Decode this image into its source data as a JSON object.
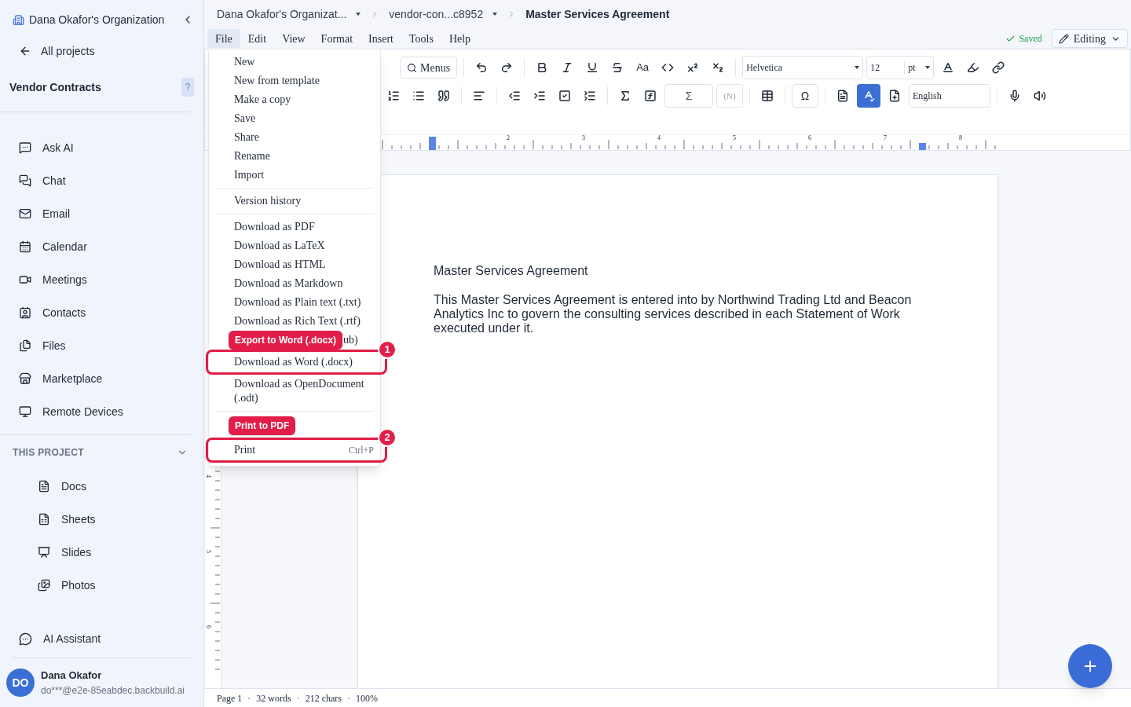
{
  "sidebar": {
    "org": "Dana Okafor's Organization",
    "back": "All projects",
    "project": "Vendor Contracts",
    "help": "?",
    "nav": [
      "Ask AI",
      "Chat",
      "Email",
      "Calendar",
      "Meetings",
      "Contacts",
      "Files",
      "Marketplace",
      "Remote Devices"
    ],
    "section": {
      "title": "THIS PROJECT",
      "expanded": true,
      "items": [
        "Docs",
        "Sheets",
        "Slides",
        "Photos"
      ]
    },
    "assistant": "AI Assistant",
    "user": {
      "initials": "DO",
      "name": "Dana Okafor",
      "email": "do***@e2e-85eabdec.backbuild.ai"
    }
  },
  "breadcrumb": [
    "Dana Okafor's Organizat...",
    "vendor-con...c8952",
    "Master Services Agreement"
  ],
  "menubar": [
    {
      "label": "File",
      "selected": true
    },
    {
      "label": "Edit",
      "selected": false
    },
    {
      "label": "View",
      "selected": false
    },
    {
      "label": "Format",
      "selected": false
    },
    {
      "label": "Insert",
      "selected": false
    },
    {
      "label": "Tools",
      "selected": false
    },
    {
      "label": "Help",
      "selected": false
    }
  ],
  "status": {
    "saved": "Saved",
    "mode": "Editing"
  },
  "toolbar": {
    "menus": "Menus",
    "case_glyph": "Aa",
    "font": "Helvetica",
    "size": "12",
    "unit": "pt",
    "sum_glyph": "Σ",
    "numbering_glyph": "(N)",
    "special_char_glyph": "Ω",
    "language": "English",
    "spellcheck_on": true
  },
  "ruler": {
    "top_labels": [
      "2",
      "3",
      "4",
      "5",
      "6",
      "7",
      "8"
    ],
    "side_labels": [
      "4",
      "5",
      "6"
    ]
  },
  "file_menu": {
    "groups": [
      [
        {
          "label": "New"
        },
        {
          "label": "New from template"
        },
        {
          "label": "Make a copy"
        },
        {
          "label": "Save"
        },
        {
          "label": "Share"
        },
        {
          "label": "Rename"
        },
        {
          "label": "Import"
        }
      ],
      [
        {
          "label": "Version history"
        }
      ],
      [
        {
          "label": "Download as PDF"
        },
        {
          "label": "Download as LaTeX"
        },
        {
          "label": "Download as HTML"
        },
        {
          "label": "Download as Markdown"
        },
        {
          "label": "Download as Plain text (.txt)"
        },
        {
          "label": "Download as Rich Text (.rtf)"
        },
        {
          "label": "ub)",
          "kind": "covered"
        },
        {
          "label": "Download as Word (.docx)",
          "callout": {
            "number": "1",
            "badge": "Export to Word (.docx)"
          }
        },
        {
          "label": "Download as OpenDocument (.odt)"
        }
      ],
      [
        {
          "label": "Print",
          "shortcut": "Ctrl+P",
          "callout": {
            "number": "2",
            "badge": "Print to PDF"
          }
        }
      ]
    ]
  },
  "document": {
    "title": "Master Services Agreement",
    "body": "This Master Services Agreement is entered into by Northwind Trading Ltd and Beacon Analytics Inc to govern the consulting services described in each Statement of Work executed under it."
  },
  "status_bar": [
    "Page 1",
    "32 words",
    "212 chars",
    "100%"
  ]
}
